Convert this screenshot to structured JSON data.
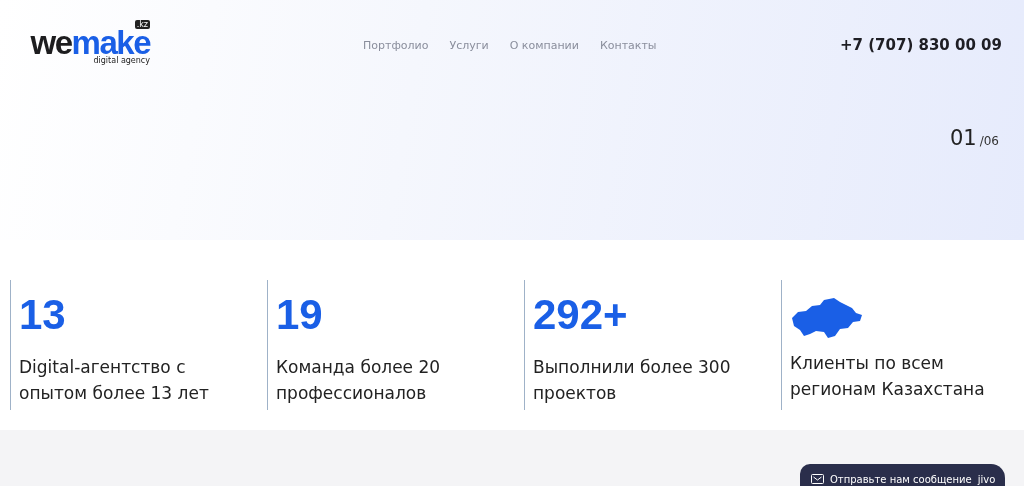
{
  "logo": {
    "word_dark": "we",
    "word_accent": "make",
    "badge": ".kz",
    "tagline": "digital agency"
  },
  "nav": [
    "Портфолио",
    "Услуги",
    "О компании",
    "Контакты"
  ],
  "phone": "+7 (707) 830 00 09",
  "slide_counter": {
    "current": "01",
    "total": "/06"
  },
  "stats": [
    {
      "kind": "number",
      "value": "13",
      "text": "Digital-агентство с опытом более 13 лет"
    },
    {
      "kind": "number",
      "value": "19",
      "text": "Команда более 20 профессионалов"
    },
    {
      "kind": "number",
      "value": "292+",
      "text": "Выполнили более 300 проектов"
    },
    {
      "kind": "map",
      "text": "Клиенты по всем регионам Казахстана"
    }
  ],
  "chat_widget": {
    "label": "Отправьте нам сообщение",
    "brand": "jivo"
  }
}
